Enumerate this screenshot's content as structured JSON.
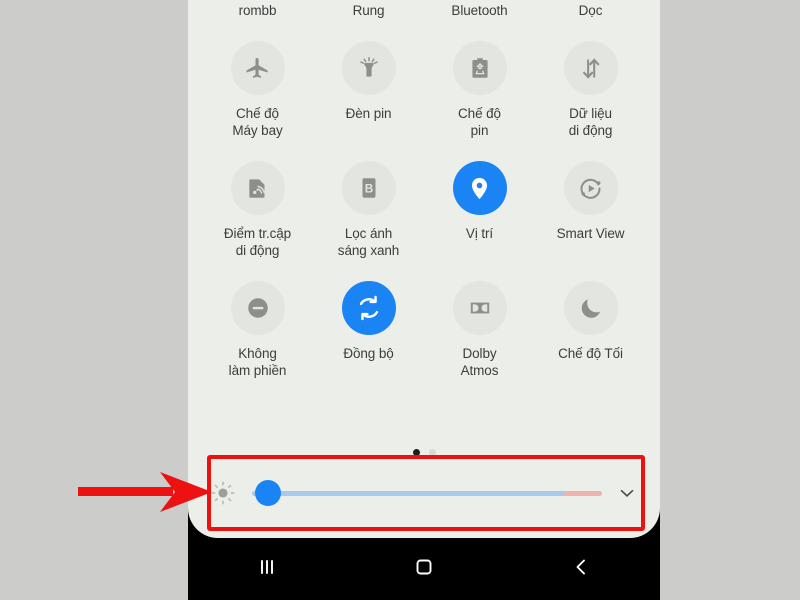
{
  "screen": {
    "panel_bg": "#eceee9",
    "accent_on": "#1a84f5",
    "tile_off_bg": "#e3e6e0",
    "label_color": "#3b3f3c",
    "outer_bg": "#ccccca",
    "annotation_color": "#ee1111"
  },
  "quick_settings": {
    "tiles": [
      {
        "label": "rombb",
        "icon": "bluetooth-audio-icon",
        "state": "on"
      },
      {
        "label": "Rung",
        "icon": "vibrate-icon",
        "state": "on"
      },
      {
        "label": "Bluetooth",
        "icon": "bluetooth-icon",
        "state": "on"
      },
      {
        "label": "Dọc",
        "icon": "auto-rotate-icon",
        "state": "off"
      },
      {
        "label": "Chế độ\nMáy bay",
        "icon": "airplane-icon",
        "state": "off"
      },
      {
        "label": "Đèn pin",
        "icon": "flashlight-icon",
        "state": "off"
      },
      {
        "label": "Chế độ\npin",
        "icon": "battery-saver-icon",
        "state": "off"
      },
      {
        "label": "Dữ liệu\ndi động",
        "icon": "mobile-data-icon",
        "state": "off"
      },
      {
        "label": "Điểm tr.cập\ndi động",
        "icon": "hotspot-icon",
        "state": "off"
      },
      {
        "label": "Lọc ánh\nsáng xanh",
        "icon": "blue-light-filter-icon",
        "state": "off"
      },
      {
        "label": "Vị trí",
        "icon": "location-pin-icon",
        "state": "on"
      },
      {
        "label": "Smart View",
        "icon": "smart-view-icon",
        "state": "off"
      },
      {
        "label": "Không\nlàm phiền",
        "icon": "do-not-disturb-icon",
        "state": "off"
      },
      {
        "label": "Đồng bộ",
        "icon": "sync-icon",
        "state": "on"
      },
      {
        "label": "Dolby\nAtmos",
        "icon": "dolby-atmos-icon",
        "state": "off"
      },
      {
        "label": "Chế độ Tối",
        "icon": "dark-mode-moon-icon",
        "state": "off"
      }
    ],
    "pages": {
      "count": 2,
      "active_index": 0
    }
  },
  "brightness": {
    "icon": "brightness-sun-icon",
    "value_percent": 5,
    "track_blue_percent": 90,
    "track_red_percent": 11,
    "expand_icon": "chevron-down-icon"
  },
  "nav_bar": {
    "buttons": [
      {
        "name": "recents-button",
        "icon": "recents-icon"
      },
      {
        "name": "home-button",
        "icon": "home-square-icon"
      },
      {
        "name": "back-button",
        "icon": "back-chevron-icon"
      }
    ]
  },
  "annotations": {
    "highlight_box": "brightness-slider-highlight",
    "arrow": "pointer-arrow-right"
  }
}
